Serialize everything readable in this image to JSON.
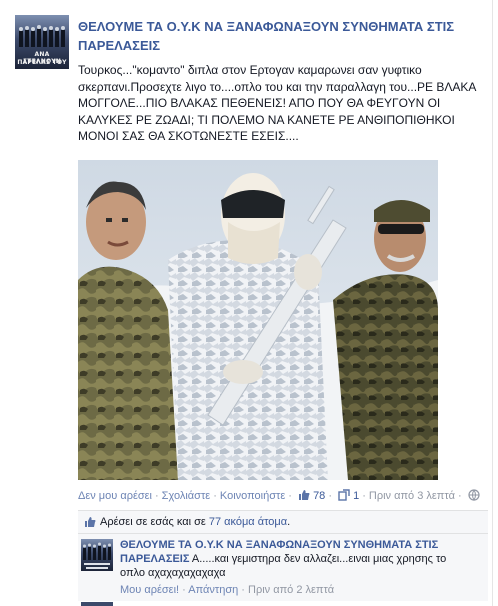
{
  "page": {
    "name": "ΘΕΛΟΥΜΕ ΤΑ Ο.Υ.Κ ΝΑ ΞΑΝΑΦΩΝΑΞΟΥΝ ΣΥΝΘΗΜΑΤΑ ΣΤΙΣ ΠΑΡΕΛΑΣΕΙΣ",
    "avatar_caption_1": "ΑΝΑ ΣΤΕΛΝΟΥΝ",
    "avatar_caption_2": "ΠΑΡΕΛΑΣ ΤΟΥ"
  },
  "post": {
    "text_1": "Τουρκος...\"κομαντο\" διπλα στον Ερτογαν καμαρωνει σαν γυφτικο σκερπανι.Προσεχτε λιγο το....οπλο του και την παραλλαγη του...ΡΕ ΒΛΑΚΑ ΜΟΓΓΟΛΕ...ΠΙΟ ΒΛΑΚΑΣ ΠΕΘΕΝΕΙΣ! ΑΠΟ ΠΟΥ ΘΑ ΦΕΥΓΟΥΝ ΟΙ ΚΑΛΥΚΕΣ ΡΕ ΖΩΑΔΙ; ΤΙ ΠΟΛΕΜΟ ΝΑ ΚΑΝΕΤΕ ΡΕ ΑΝΘΙΠΟΠΙΘΗΚΟΙ ΜΟΝΟΙ ΣΑΣ ΘΑ ΣΚΟΤΩΝΕΣΤΕ ΕΣΕΙΣ...."
  },
  "actions": {
    "unlike": "Δεν μου αρέσει",
    "comment": "Σχολιάστε",
    "share": "Κοινοποιήστε",
    "like_count": "78",
    "share_count": "1",
    "time": "Πριν από 3 λεπτά"
  },
  "likes": {
    "prefix": "Αρέσει σε εσάς και σε ",
    "others": "77 ακόμα άτομα",
    "suffix": "."
  },
  "comment": {
    "author": "ΘΕΛΟΥΜΕ ΤΑ Ο.Υ.Κ ΝΑ ΞΑΝΑΦΩΝΑΞΟΥΝ ΣΥΝΘΗΜΑΤΑ ΣΤΙΣ ΠΑΡΕΛΑΣΕΙΣ",
    "text": " Α.....και γεμιστηρα δεν αλλαζει...ειναι μιας χρησης το οπλο αχαχαχαχαχαχα",
    "like_link": "Μου αρέσει!",
    "reply_link": "Απάντηση",
    "time": "Πριν από 2 λεπτά"
  },
  "colors": {
    "link": "#3b5998",
    "meta": "#9197a3",
    "panel_bg": "#f6f7f9"
  }
}
